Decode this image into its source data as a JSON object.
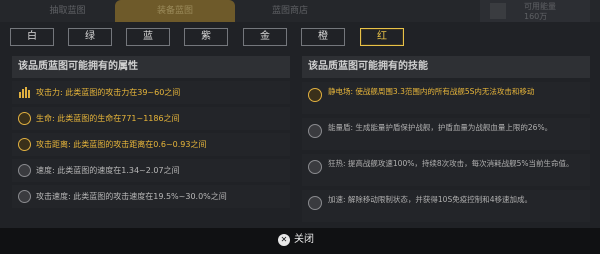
{
  "background_tabs": [
    "抽取蓝图",
    "装备蓝图",
    "蓝图商店"
  ],
  "background_corner": {
    "label": "可用能量",
    "value": "160万"
  },
  "quality_tabs": [
    {
      "label": "白",
      "active": false
    },
    {
      "label": "绿",
      "active": false
    },
    {
      "label": "蓝",
      "active": false
    },
    {
      "label": "紫",
      "active": false
    },
    {
      "label": "金",
      "active": false
    },
    {
      "label": "橙",
      "active": false
    },
    {
      "label": "红",
      "active": true
    }
  ],
  "attributes": {
    "title": "该品质蓝图可能拥有的属性",
    "items": [
      {
        "icon": "attack-power-icon",
        "text": "攻击力: 此类蓝图的攻击力在39~60之间",
        "highlight": true
      },
      {
        "icon": "health-icon",
        "text": "生命: 此类蓝图的生命在771~1186之间",
        "highlight": true
      },
      {
        "icon": "range-icon",
        "text": "攻击距离: 此类蓝图的攻击距离在0.6~0.93之间",
        "highlight": true
      },
      {
        "icon": "speed-icon",
        "text": "速度: 此类蓝图的速度在1.34~2.07之间",
        "highlight": false
      },
      {
        "icon": "attack-speed-icon",
        "text": "攻击速度: 此类蓝图的攻击速度在19.5%~30.0%之间",
        "highlight": false
      }
    ]
  },
  "skills": {
    "title": "该品质蓝图可能拥有的技能",
    "items": [
      {
        "icon": "static-field-icon",
        "text": "静电场: 使战舰周围3.3范围内的所有战舰5S内无法攻击和移动",
        "highlight": true
      },
      {
        "icon": "energy-shield-icon",
        "text": "能量盾: 生成能量护盾保护战舰，护盾血量为战舰血量上限的26%。",
        "highlight": false
      },
      {
        "icon": "frenzy-icon",
        "text": "狂热: 提高战舰攻速100%，持续8次攻击，每次消耗战舰5%当前生命值。",
        "highlight": false
      },
      {
        "icon": "accelerate-icon",
        "text": "加速: 解除移动限制状态，并获得10S免疫控制和4移速加成。",
        "highlight": false
      }
    ]
  },
  "close_label": "关闭"
}
